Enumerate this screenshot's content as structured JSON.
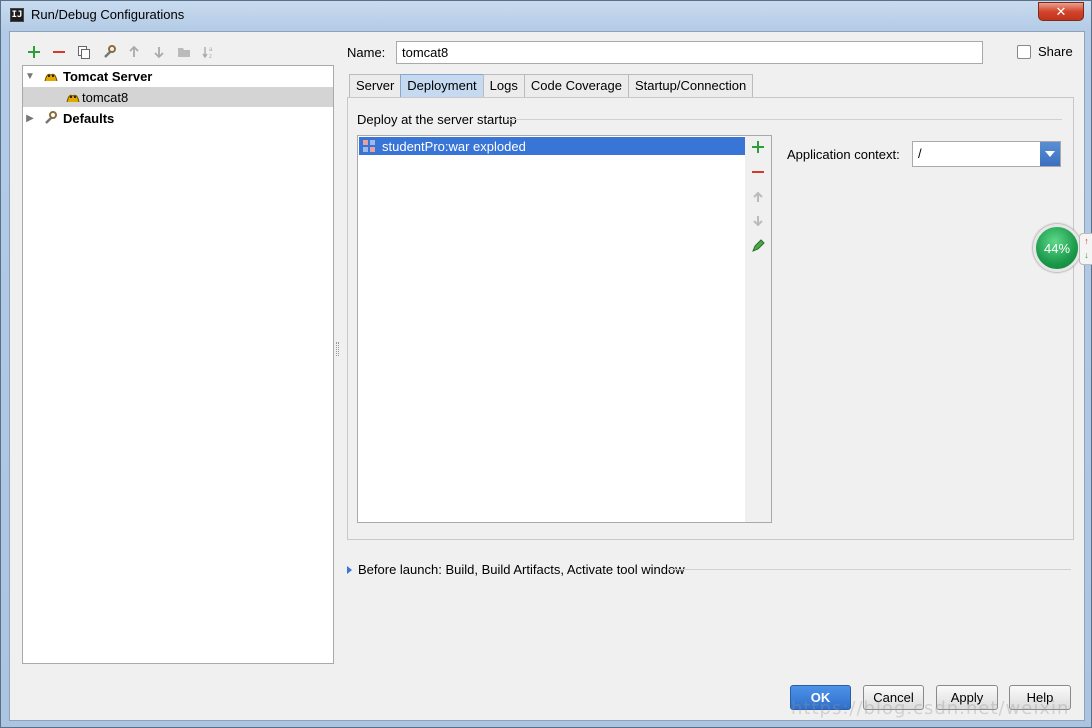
{
  "window": {
    "title": "Run/Debug Configurations",
    "app_icon": "IJ"
  },
  "toolbar": {
    "icons": [
      "add-icon",
      "remove-icon",
      "copy-icon",
      "wrench-icon",
      "move-up-icon",
      "move-down-icon",
      "folder-icon",
      "sort-az-icon"
    ]
  },
  "tree": {
    "items": [
      {
        "label": "Tomcat Server",
        "expanded": true,
        "bold": true,
        "selected": false
      },
      {
        "label": "tomcat8",
        "bold": false,
        "selected": true
      },
      {
        "label": "Defaults",
        "expanded": false,
        "bold": true,
        "selected": false
      }
    ]
  },
  "form": {
    "name_label": "Name:",
    "name_value": "tomcat8",
    "share_label": "Share",
    "share_checked": false
  },
  "tabs": [
    {
      "label": "Server",
      "active": false
    },
    {
      "label": "Deployment",
      "active": true
    },
    {
      "label": "Logs",
      "active": false
    },
    {
      "label": "Code Coverage",
      "active": false
    },
    {
      "label": "Startup/Connection",
      "active": false
    }
  ],
  "deployment": {
    "section_label": "Deploy at the server startup",
    "artifacts": [
      "studentPro:war exploded"
    ],
    "app_context_label": "Application context:",
    "app_context_value": "/"
  },
  "before_launch": "Before launch: Build, Build Artifacts, Activate tool window",
  "buttons": {
    "ok": "OK",
    "cancel": "Cancel",
    "apply": "Apply",
    "help": "Help"
  },
  "overlay": {
    "speed_percent": "44%"
  },
  "watermark": "https://blog.csdn.net/weixin",
  "colors": {
    "selection": "#3875d7",
    "ok_button": "#2f6fcb",
    "speed_ball": "#1a9a4a"
  }
}
